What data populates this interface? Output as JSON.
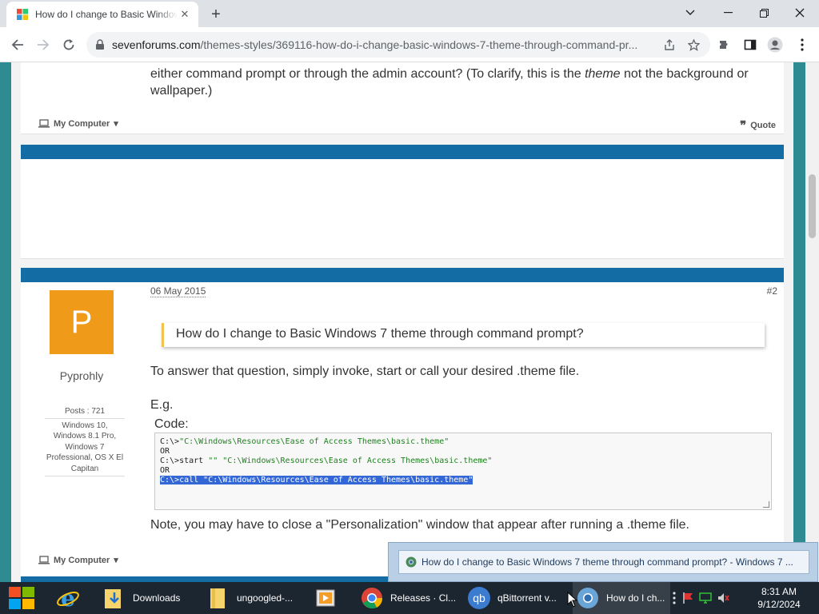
{
  "browser": {
    "tab_title": "How do I change to Basic Windows 7 theme through command prompt?",
    "url_domain": "sevenforums.com",
    "url_path": "/themes-styles/369116-how-do-i-change-basic-windows-7-theme-through-command-pr..."
  },
  "post1": {
    "text_line1": "either command prompt or through the admin account? (To clarify, this is the",
    "text_em": "theme",
    "text_line1b": "not the background or",
    "text_line2": "wallpaper.)",
    "my_computer": "My Computer",
    "quote": "Quote"
  },
  "post2": {
    "date": "06 May 2015",
    "number": "#2",
    "avatar_letter": "P",
    "username": "Pyprohly",
    "posts": "Posts : 721",
    "system": "Windows 10, Windows 8.1 Pro, Windows 7 Professional, OS X El Capitan",
    "quote_text": "How do I change to Basic Windows 7 theme through command prompt?",
    "answer": "To answer that question, simply invoke, start or call your desired .theme file.",
    "eg": "E.g.",
    "code_label": "Code:",
    "code_prompt1": "C:\\>",
    "code_str1": "\"C:\\Windows\\Resources\\Ease of Access Themes\\basic.theme\"",
    "code_or1": "OR",
    "code_prompt2": "C:\\>start ",
    "code_str2a": "\"\"",
    "code_str2b": " \"C:\\Windows\\Resources\\Ease of Access Themes\\basic.theme\"",
    "code_or2": "OR",
    "code_line3": "C:\\>call \"C:\\Windows\\Resources\\Ease of Access Themes\\basic.theme\"",
    "note": "Note, you may have to close a \"Personalization\" window that appear after running a .theme file.",
    "my_computer": "My Computer"
  },
  "tooltip": {
    "text": "How do I change to Basic Windows 7 theme through command prompt? - Windows 7 ..."
  },
  "taskbar": {
    "items": [
      {
        "label": "Downloads"
      },
      {
        "label": "ungoogled-..."
      },
      {
        "label": ""
      },
      {
        "label": "Releases · Cl..."
      },
      {
        "label": "qBittorrent v..."
      },
      {
        "label": "How do I ch..."
      }
    ],
    "time": "8:31 AM",
    "date": "9/12/2024"
  },
  "colors": {
    "accent_blue": "#136ca4",
    "teal_background": "#2e8b92",
    "avatar_orange": "#f09a1a",
    "quote_bar": "#f0c34e"
  }
}
